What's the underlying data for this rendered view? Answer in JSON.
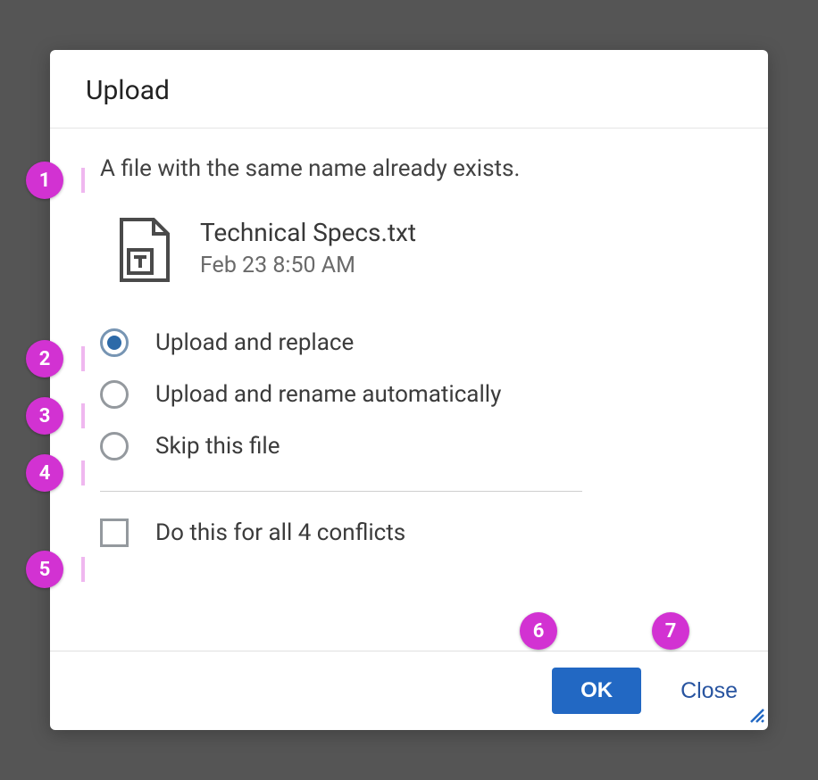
{
  "dialog": {
    "title": "Upload",
    "message": "A file with the same name already exists.",
    "file": {
      "name": "Technical Specs.txt",
      "date": "Feb 23 8:50 AM"
    },
    "options": [
      {
        "label": "Upload and replace",
        "checked": true
      },
      {
        "label": "Upload and rename automatically",
        "checked": false
      },
      {
        "label": "Skip this file",
        "checked": false
      }
    ],
    "applyAll": {
      "label": "Do this for all 4 conflicts",
      "checked": false
    },
    "buttons": {
      "ok": "OK",
      "close": "Close"
    }
  },
  "markers": [
    "1",
    "2",
    "3",
    "4",
    "5",
    "6",
    "7"
  ]
}
